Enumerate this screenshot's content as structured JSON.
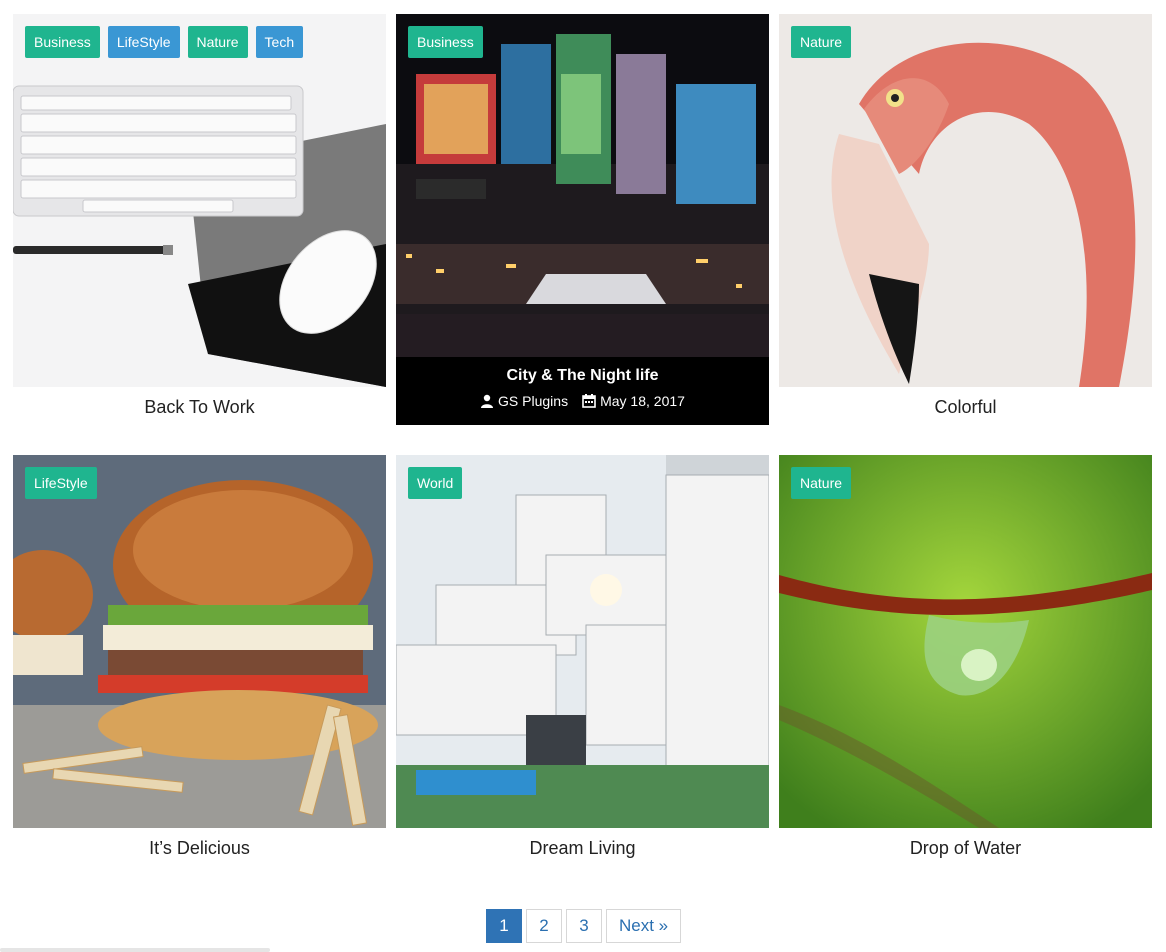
{
  "posts": [
    {
      "title": "Back To Work",
      "tags": [
        {
          "label": "Business",
          "color": "#1fb58f"
        },
        {
          "label": "LifeStyle",
          "color": "#3a97d4"
        },
        {
          "label": "Nature",
          "color": "#1fb58f"
        },
        {
          "label": "Tech",
          "color": "#3a97d4"
        }
      ]
    },
    {
      "title": "City & The Night life",
      "author": "GS Plugins",
      "date": "May 18, 2017",
      "tags": [
        {
          "label": "Business",
          "color": "#1fb58f"
        }
      ]
    },
    {
      "title": "Colorful",
      "tags": [
        {
          "label": "Nature",
          "color": "#1fb58f"
        }
      ]
    },
    {
      "title": "It’s Delicious",
      "tags": [
        {
          "label": "LifeStyle",
          "color": "#1fb58f"
        }
      ]
    },
    {
      "title": "Dream Living",
      "tags": [
        {
          "label": "World",
          "color": "#1fb58f"
        }
      ]
    },
    {
      "title": "Drop of Water",
      "tags": [
        {
          "label": "Nature",
          "color": "#1fb58f"
        }
      ]
    }
  ],
  "pagination": {
    "pages": [
      "1",
      "2",
      "3"
    ],
    "active": "1",
    "next": "Next »"
  },
  "icons": {
    "author": "user-icon",
    "date": "calendar-icon"
  }
}
